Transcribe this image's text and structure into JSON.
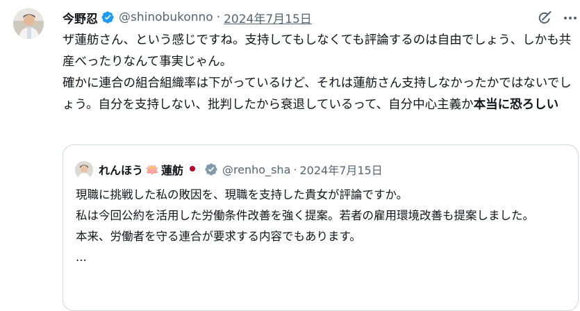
{
  "tweet": {
    "author": {
      "display_name": "今野忍",
      "handle": "@shinobukonno",
      "verified_badge_color": "#1d9bf0"
    },
    "separator": "·",
    "date": "2024年7月15日",
    "text_regular": "ザ蓮舫さん、という感じですね。支持してもしなくても評論するのは自由でしょう、しかも共産べったりなんて事実じゃん。\n確かに連合の組合組織率は下がっているけど、それは蓮舫さん支持しなかったかではないでしょう。自分を支持しない、批判したから衰退しているって、自分中心主義か",
    "text_bold": "本当に恐ろしい",
    "icons": {
      "grok": "grok-icon",
      "more": "more-icon"
    }
  },
  "quoted": {
    "author": {
      "name_part1": "れんほう",
      "lotus": "🪷",
      "name_part2": "蓮舫",
      "flag": "🇯🇵",
      "handle": "@renho_sha",
      "verified_badge_color": "#829aab"
    },
    "separator": "·",
    "date": "2024年7月15日",
    "text": "現職に挑戦した私の敗因を、現職を支持した貴女が評論ですか。\n私は今回公約を活用した労働条件改善を強く提案。若者の雇用環境改善も提案しました。\n本来、労働者を守る連合が要求する内容でもあります。\n..."
  }
}
